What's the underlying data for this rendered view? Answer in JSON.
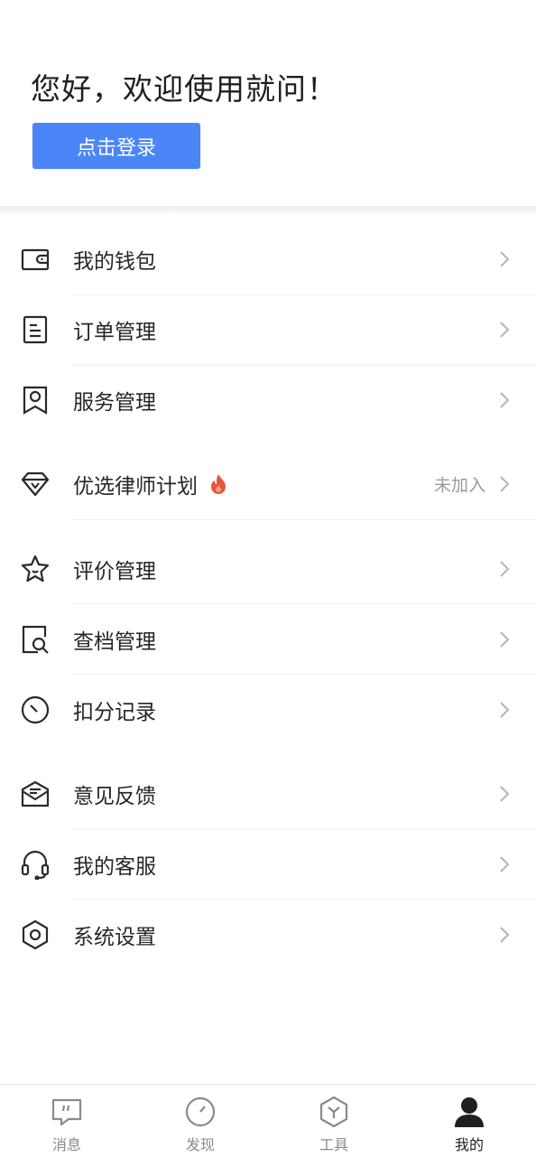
{
  "header": {
    "greeting": "您好，欢迎使用就问！",
    "login_button": "点击登录"
  },
  "menu": [
    {
      "id": "wallet",
      "label": "我的钱包",
      "icon": "wallet-icon"
    },
    {
      "id": "orders",
      "label": "订单管理",
      "icon": "document-icon"
    },
    {
      "id": "services",
      "label": "服务管理",
      "icon": "person-card-icon"
    },
    {
      "id": "premium-lawyer",
      "label": "优选律师计划",
      "icon": "diamond-icon",
      "badge_icon": "fire-icon",
      "status": "未加入"
    },
    {
      "id": "reviews",
      "label": "评价管理",
      "icon": "star-icon"
    },
    {
      "id": "archive",
      "label": "查档管理",
      "icon": "search-document-icon"
    },
    {
      "id": "deductions",
      "label": "扣分记录",
      "icon": "clock-icon"
    },
    {
      "id": "feedback",
      "label": "意见反馈",
      "icon": "mail-icon"
    },
    {
      "id": "support",
      "label": "我的客服",
      "icon": "headset-icon"
    },
    {
      "id": "settings",
      "label": "系统设置",
      "icon": "hexagon-settings-icon"
    }
  ],
  "tabbar": [
    {
      "id": "messages",
      "label": "消息",
      "icon": "chat-bubble-icon",
      "active": false
    },
    {
      "id": "discover",
      "label": "发现",
      "icon": "compass-icon",
      "active": false
    },
    {
      "id": "tools",
      "label": "工具",
      "icon": "cube-icon",
      "active": false
    },
    {
      "id": "mine",
      "label": "我的",
      "icon": "user-icon",
      "active": true
    }
  ],
  "colors": {
    "primary": "#4a86f7",
    "text": "#262626",
    "muted": "#9a9a9a",
    "fire": "#e8553a"
  }
}
